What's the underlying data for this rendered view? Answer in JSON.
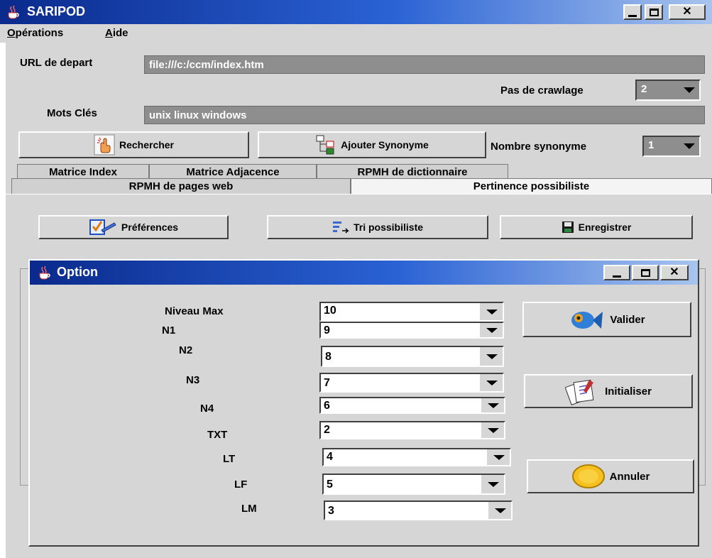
{
  "window": {
    "title": "SARIPOD"
  },
  "menu": [
    {
      "label": "Opérations",
      "mnemonic": "O",
      "rest": "pérations"
    },
    {
      "label": "Aide",
      "mnemonic": "A",
      "rest": "ide"
    }
  ],
  "form": {
    "url_label": "URL de depart",
    "url_value": "file:///c:/ccm/index.htm",
    "crawl_label": "Pas de crawlage",
    "crawl_value": "2",
    "keywords_label": "Mots Clés",
    "keywords_value": "unix linux windows",
    "synonyms_label": "Nombre synonyme",
    "synonyms_value": "1"
  },
  "actions": {
    "search": "Rechercher",
    "add_synonym": "Ajouter Synonyme"
  },
  "tabs_row1": [
    "Matrice Index",
    "Matrice Adjacence",
    "RPMH de dictionnaire"
  ],
  "tabs_row2": [
    "RPMH de pages web",
    "Pertinence possibiliste"
  ],
  "active_tab": "Pertinence possibiliste",
  "toolbar": {
    "preferences": "Préférences",
    "sort": "Tri possibiliste",
    "save": "Enregistrer"
  },
  "dialog": {
    "title": "Option",
    "fields": [
      {
        "label": "Niveau Max",
        "value": "10"
      },
      {
        "label": "N1",
        "value": "9"
      },
      {
        "label": "N2",
        "value": "8"
      },
      {
        "label": "N3",
        "value": "7"
      },
      {
        "label": "N4",
        "value": "6"
      },
      {
        "label": "TXT",
        "value": "2"
      },
      {
        "label": "LT",
        "value": "4"
      },
      {
        "label": "LF",
        "value": "5"
      },
      {
        "label": "LM",
        "value": "3"
      }
    ],
    "buttons": {
      "validate": "Valider",
      "reset": "Initialiser",
      "cancel": "Annuler"
    }
  },
  "colors": {
    "title_gradient_start": "#0a2a8c",
    "title_gradient_end": "#a8c4ee",
    "window_bg": "#d6d6d6",
    "field_bg": "#8e8e8e"
  }
}
